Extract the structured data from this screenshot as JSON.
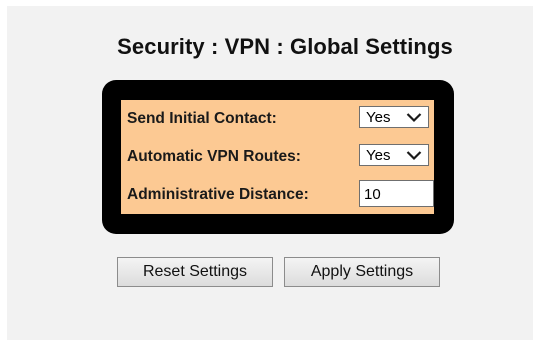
{
  "page": {
    "title": "Security : VPN : Global Settings"
  },
  "settings": {
    "send_initial_contact": {
      "label": "Send Initial Contact:",
      "value": "Yes"
    },
    "automatic_vpn_routes": {
      "label": "Automatic VPN Routes:",
      "value": "Yes"
    },
    "administrative_distance": {
      "label": "Administrative Distance:",
      "value": "10"
    }
  },
  "buttons": {
    "reset_label": "Reset Settings",
    "apply_label": "Apply Settings"
  },
  "colors": {
    "panel_background": "#fcc993",
    "frame": "#000000",
    "page_background": "#f2f2f2"
  },
  "icons": {
    "dropdown": "chevron-down-icon"
  }
}
